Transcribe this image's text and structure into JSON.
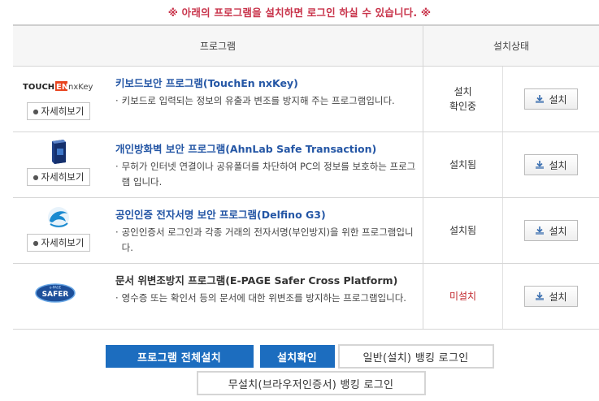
{
  "notice": "※ 아래의 프로그램을 설치하면 로그인 하실 수 있습니다. ※",
  "table": {
    "header_program": "프로그램",
    "header_status": "설치상태"
  },
  "programs": [
    {
      "logo_icon": "touchen-nxkey-logo",
      "logo_text": [
        "TOUCH",
        "EN",
        "nxKey"
      ],
      "has_detail": true,
      "detail_label": "자세히보기",
      "title": "키보드보안 프로그램(TouchEn nxKey)",
      "desc": "키보드로 입력되는 정보의 유출과 변조를 방지해 주는 프로그램입니다.",
      "status": "설치\n확인중",
      "status_color": "#333333",
      "install_label": "설치"
    },
    {
      "logo_icon": "ahnlab-box-icon",
      "has_detail": true,
      "detail_label": "자세히보기",
      "title": "개인방화벽 보안 프로그램(AhnLab Safe Transaction)",
      "desc": "무허가 인터넷 연결이나 공유폴더를 차단하여 PC의 정보를 보호하는 프로그램 입니다.",
      "status": "설치됨",
      "status_color": "#333333",
      "install_label": "설치"
    },
    {
      "logo_icon": "delfino-dolphin-icon",
      "has_detail": true,
      "detail_label": "자세히보기",
      "title": "공인인증 전자서명 보안 프로그램(Delfino G3)",
      "desc": "공인인증서 로그인과 각종 거래의 전자서명(부인방지)을 위한 프로그램입니다.",
      "status": "설치됨",
      "status_color": "#333333",
      "install_label": "설치"
    },
    {
      "logo_icon": "epage-safer-logo",
      "logo_text": [
        "e-PAGE",
        "SAFER"
      ],
      "has_detail": false,
      "title": "문서 위변조방지 프로그램(E-PAGE Safer Cross Platform)",
      "desc": "영수증 또는 확인서 등의 문서에 대한 위변조를 방지하는 프로그램입니다.",
      "status": "미설치",
      "status_color": "#c1272d",
      "install_label": "설치"
    }
  ],
  "actions": {
    "install_all": "프로그램 전체설치",
    "check_install": "설치확인",
    "general_login": "일반(설치) 뱅킹 로그인",
    "noinstall_login": "무설치(브라우저인증서) 뱅킹 로그인"
  },
  "colors": {
    "notice": "#c8334a",
    "title": "#2456a5",
    "primary_button": "#1c6dbf"
  }
}
